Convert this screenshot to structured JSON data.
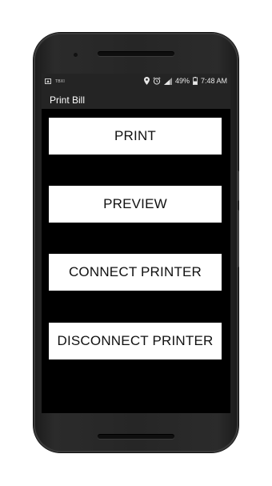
{
  "status_bar": {
    "carrier": "TBXI",
    "battery_percent": "49%",
    "time": "7:48 AM",
    "icons": [
      "image-icon",
      "location-icon",
      "alarm-icon",
      "signal-icon",
      "battery-icon"
    ]
  },
  "action_bar": {
    "title": "Print Bill"
  },
  "buttons": {
    "print": "PRINT",
    "preview": "PREVIEW",
    "connect": "CONNECT PRINTER",
    "disconnect": "DISCONNECT PRINTER"
  },
  "colors": {
    "screen_background": "#000000",
    "bar_background": "#242424",
    "button_background": "#ffffff",
    "button_text": "#111111"
  }
}
